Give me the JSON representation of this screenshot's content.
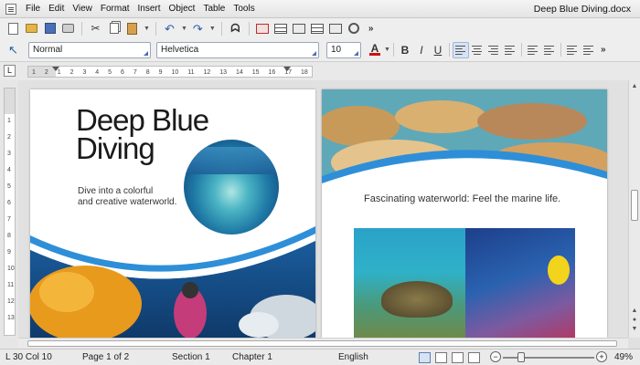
{
  "window": {
    "title": "Deep Blue Diving.docx"
  },
  "menu": [
    "File",
    "Edit",
    "View",
    "Format",
    "Insert",
    "Object",
    "Table",
    "Tools"
  ],
  "toolbar": {
    "paragraph_style": "Normal",
    "font_name": "Helvetica",
    "font_size": "10",
    "more_label": "»",
    "font_color": "#d01010"
  },
  "ruler": {
    "ticks": [
      "1",
      "2",
      "1",
      "2",
      "3",
      "4",
      "5",
      "6",
      "7",
      "8",
      "9",
      "10",
      "11",
      "12",
      "13",
      "14",
      "15",
      "16",
      "17",
      "18"
    ]
  },
  "vruler": {
    "ticks": [
      "1",
      "2",
      "3",
      "4",
      "5",
      "6",
      "7",
      "8",
      "9",
      "10",
      "11",
      "12",
      "13"
    ]
  },
  "document": {
    "left_page": {
      "title_line1": "Deep Blue",
      "title_line2": "Diving",
      "subtitle_line1": "Dive into a colorful",
      "subtitle_line2": "and creative waterworld."
    },
    "right_page": {
      "caption": "Fascinating waterworld: Feel the marine life."
    }
  },
  "status": {
    "position": "L 30 Col 10",
    "page": "Page 1 of 2",
    "section": "Section 1",
    "chapter": "Chapter 1",
    "language": "English",
    "zoom": "49%"
  },
  "colors": {
    "accent_blue": "#2e8fd8",
    "selection": "#d7e3f3"
  }
}
